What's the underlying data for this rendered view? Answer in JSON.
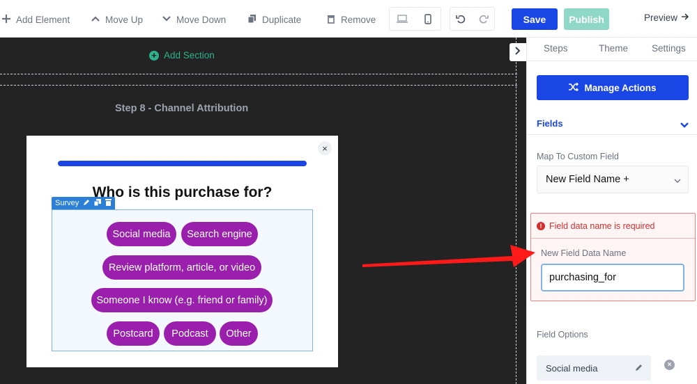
{
  "toolbar": {
    "add_element": "Add Element",
    "move_up": "Move Up",
    "move_down": "Move Down",
    "duplicate": "Duplicate",
    "remove": "Remove",
    "save": "Save",
    "publish": "Publish",
    "preview": "Preview"
  },
  "canvas": {
    "add_section": "Add Section",
    "step_title": "Step 8 - Channel Attribution",
    "modal": {
      "close": "×",
      "question": "Who is this purchase for?",
      "survey_tag": "Survey",
      "options": [
        "Social media",
        "Search engine",
        "Review platform, article, or video",
        "Someone I know (e.g. friend or family)",
        "Postcard",
        "Podcast",
        "Other"
      ]
    }
  },
  "sidebar": {
    "tabs": [
      "Steps",
      "Theme",
      "Settings"
    ],
    "manage_actions": "Manage Actions",
    "fields_label": "Fields",
    "map_label": "Map To Custom Field",
    "map_value": "New Field Name +",
    "error_message": "Field data name is required",
    "new_field_label": "New Field Data Name",
    "new_field_value": "purchasing_for",
    "field_options_label": "Field Options",
    "first_option": "Social media"
  },
  "colors": {
    "primary": "#1a46e6",
    "publish": "#8fd7c6",
    "accent_green": "#2db08c",
    "pill": "#9a1fad",
    "error": "#d32f2f",
    "arrow": "#ff1a1a"
  }
}
